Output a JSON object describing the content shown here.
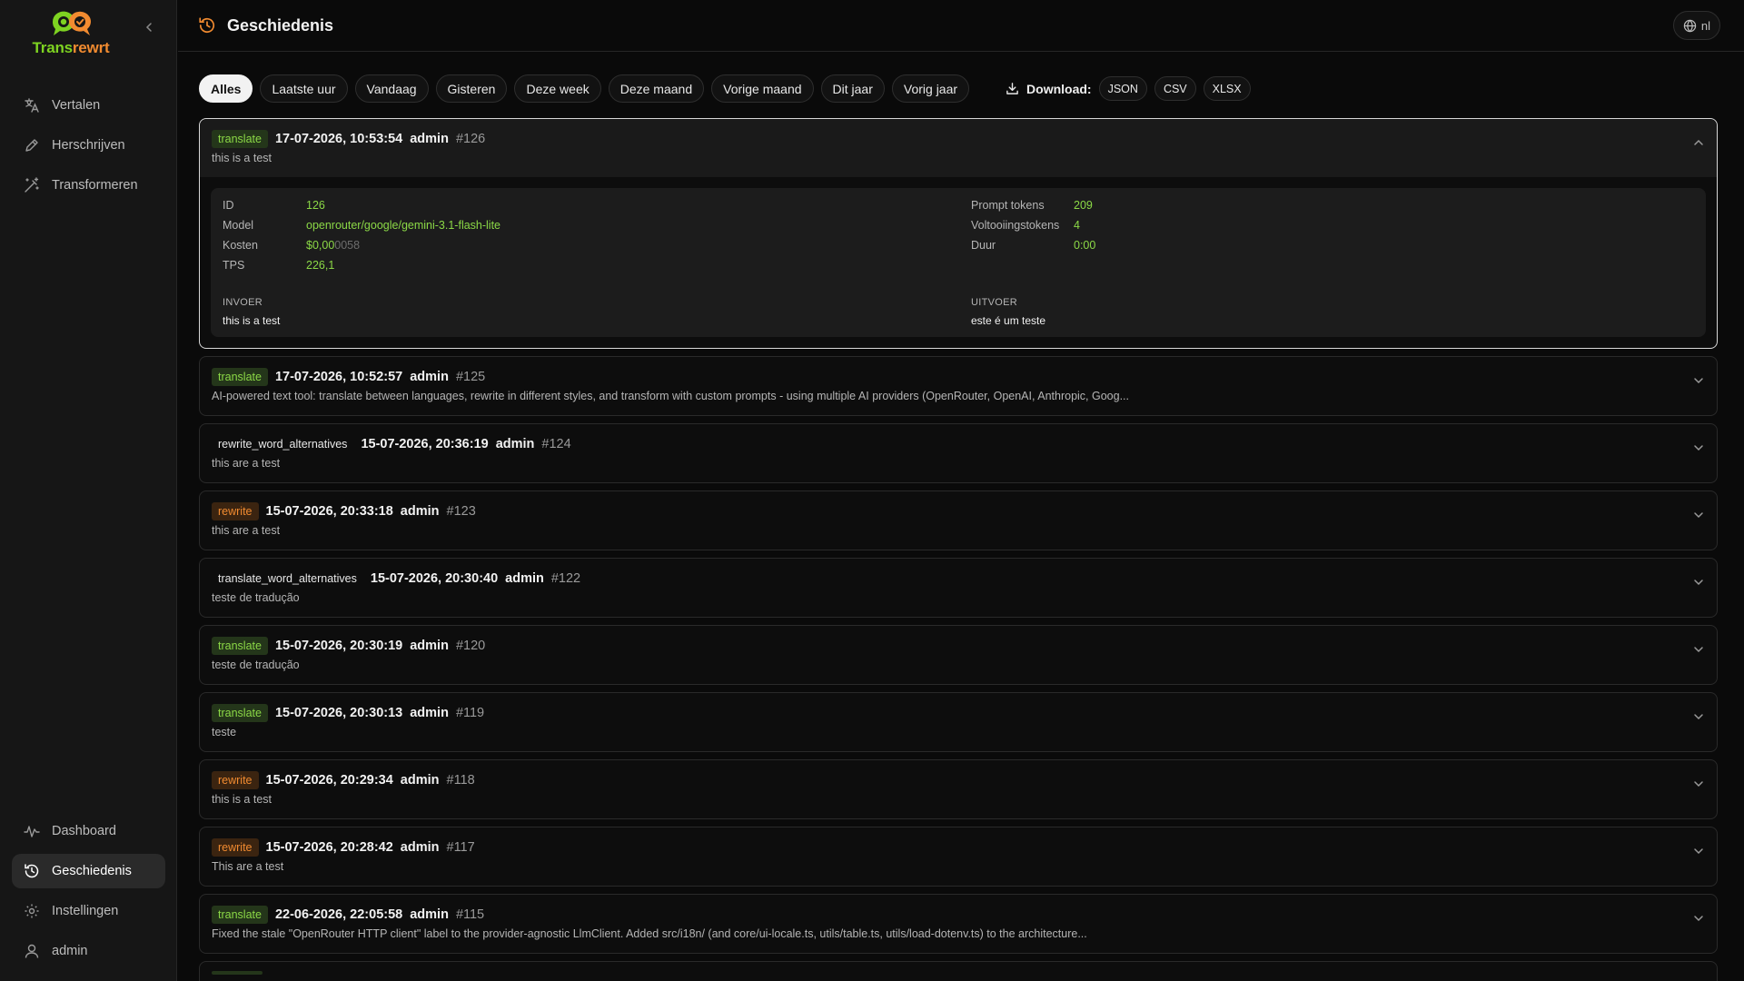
{
  "app": {
    "name_part1": "Trans",
    "name_part2": "rewrt"
  },
  "sidebar": {
    "top_items": [
      {
        "label": "Vertalen",
        "icon": "translate-icon"
      },
      {
        "label": "Herschrijven",
        "icon": "pen-icon"
      },
      {
        "label": "Transformeren",
        "icon": "magic-wand-icon"
      }
    ],
    "bottom_items": [
      {
        "label": "Dashboard",
        "icon": "activity-icon"
      },
      {
        "label": "Geschiedenis",
        "icon": "history-icon",
        "active": true
      },
      {
        "label": "Instellingen",
        "icon": "gear-icon"
      },
      {
        "label": "admin",
        "icon": "user-icon"
      }
    ]
  },
  "header": {
    "title": "Geschiedenis",
    "lang": "nl"
  },
  "filters": {
    "items": [
      "Alles",
      "Laatste uur",
      "Vandaag",
      "Gisteren",
      "Deze week",
      "Deze maand",
      "Vorige maand",
      "Dit jaar",
      "Vorig jaar"
    ],
    "active": "Alles",
    "download_label": "Download:",
    "formats": [
      "JSON",
      "CSV",
      "XLSX"
    ]
  },
  "history": [
    {
      "type": "translate",
      "badge": "translate",
      "datetime": "17-07-2026, 10:53:54",
      "user": "admin",
      "id": "#126",
      "preview": "this is a test",
      "expanded": true,
      "details": {
        "left": [
          {
            "label": "ID",
            "value": "126"
          },
          {
            "label": "Model",
            "value": "openrouter/google/gemini-3.1-flash-lite"
          },
          {
            "label": "Kosten",
            "value": "$0,00",
            "value_dim": "0058"
          },
          {
            "label": "TPS",
            "value": "226,1"
          }
        ],
        "right": [
          {
            "label": "Prompt tokens",
            "value": "209"
          },
          {
            "label": "Voltooiingstokens",
            "value": "4"
          },
          {
            "label": "Duur",
            "value": "0:00"
          }
        ],
        "input_label": "INVOER",
        "input_text": "this is a test",
        "output_label": "UITVOER",
        "output_text": "este é um teste"
      }
    },
    {
      "type": "translate",
      "badge": "translate",
      "datetime": "17-07-2026, 10:52:57",
      "user": "admin",
      "id": "#125",
      "preview": "AI-powered text tool: translate between languages, rewrite in different styles, and transform with custom prompts - using multiple AI providers (OpenRouter, OpenAI, Anthropic, Goog..."
    },
    {
      "type": "plain",
      "badge": "rewrite_word_alternatives",
      "datetime": "15-07-2026, 20:36:19",
      "user": "admin",
      "id": "#124",
      "preview": "this are a test"
    },
    {
      "type": "rewrite",
      "badge": "rewrite",
      "datetime": "15-07-2026, 20:33:18",
      "user": "admin",
      "id": "#123",
      "preview": "this are a test"
    },
    {
      "type": "plain",
      "badge": "translate_word_alternatives",
      "datetime": "15-07-2026, 20:30:40",
      "user": "admin",
      "id": "#122",
      "preview": "teste de tradução"
    },
    {
      "type": "translate",
      "badge": "translate",
      "datetime": "15-07-2026, 20:30:19",
      "user": "admin",
      "id": "#120",
      "preview": "teste de tradução"
    },
    {
      "type": "translate",
      "badge": "translate",
      "datetime": "15-07-2026, 20:30:13",
      "user": "admin",
      "id": "#119",
      "preview": "teste"
    },
    {
      "type": "rewrite",
      "badge": "rewrite",
      "datetime": "15-07-2026, 20:29:34",
      "user": "admin",
      "id": "#118",
      "preview": "this is a test"
    },
    {
      "type": "rewrite",
      "badge": "rewrite",
      "datetime": "15-07-2026, 20:28:42",
      "user": "admin",
      "id": "#117",
      "preview": "This are a test"
    },
    {
      "type": "translate",
      "badge": "translate",
      "datetime": "22-06-2026, 22:05:58",
      "user": "admin",
      "id": "#115",
      "preview": "Fixed the stale \"OpenRouter HTTP client\" label to the provider-agnostic LlmClient. Added src/i18n/ (and core/ui-locale.ts, utils/table.ts, utils/load-dotenv.ts) to the architecture..."
    }
  ],
  "colors": {
    "accent_green": "#8bd846",
    "accent_orange": "#f28b30",
    "background": "#0a0a0a",
    "sidebar": "#161616"
  }
}
